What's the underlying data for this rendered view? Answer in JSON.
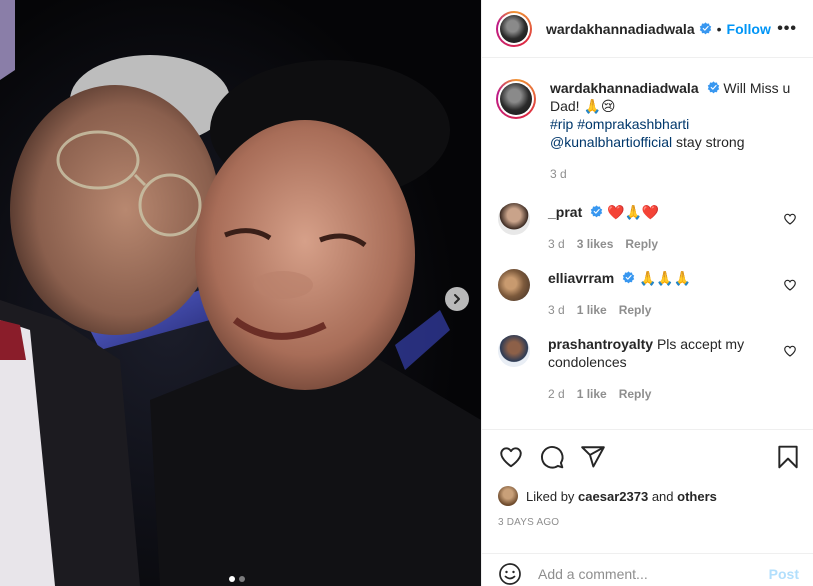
{
  "post": {
    "author": "wardakhannadiadwala",
    "follow_label": "Follow",
    "more_label": "•••",
    "separator": "•"
  },
  "caption": {
    "author": "wardakhannadiadwala",
    "text": "Will Miss u Dad! 🙏😢",
    "hashtags": "#rip #omprakashbharti",
    "mention": "@kunalbhartiofficial",
    "mention_suffix": " stay strong",
    "time": "3 d"
  },
  "comments": [
    {
      "user": "_prat",
      "verified": true,
      "text": "❤️🙏❤️",
      "time": "3 d",
      "likes": "3 likes",
      "reply": "Reply",
      "avatar_icon": "avatar-prat"
    },
    {
      "user": "elliavrram",
      "verified": true,
      "text": "🙏🙏🙏",
      "time": "3 d",
      "likes": "1 like",
      "reply": "Reply",
      "avatar_icon": "avatar-elli"
    },
    {
      "user": "prashantroyalty",
      "verified": false,
      "text": "Pls accept my condolences",
      "time": "2 d",
      "likes": "1 like",
      "reply": "Reply",
      "avatar_icon": "avatar-prashant"
    }
  ],
  "likes": {
    "prefix": "Liked by",
    "user": "caesar2373",
    "middle": "and",
    "others": "others"
  },
  "posted_time": "3 DAYS AGO",
  "add_comment": {
    "placeholder": "Add a comment...",
    "post_label": "Post"
  },
  "carousel": {
    "dots": 2,
    "active_index": 0
  },
  "colors": {
    "link": "#00376b",
    "follow": "#0095f6",
    "post_disabled": "#b2dffc",
    "verified": "#3897f0",
    "heart_red": "#ed4956"
  }
}
